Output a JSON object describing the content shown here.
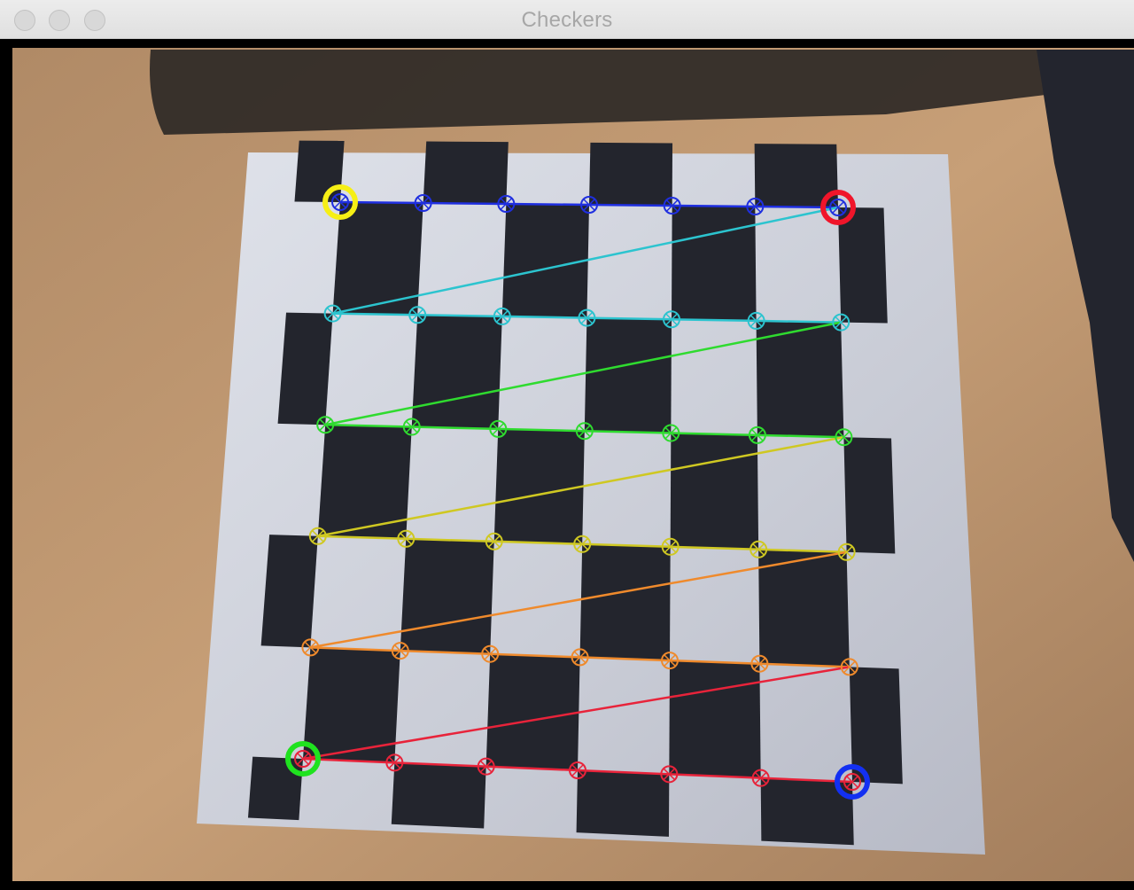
{
  "window": {
    "title": "Checkers"
  },
  "image_content": {
    "board": {
      "cols": 7,
      "rows": 6
    },
    "row_colors": [
      "#1f2fe0",
      "#2cc4cf",
      "#2fdb2f",
      "#cfc822",
      "#ef8a2c",
      "#e8233a"
    ],
    "start_markers": [
      {
        "corner": "first",
        "color": "#f6ef15"
      },
      {
        "corner": "top-right",
        "color": "#f0152a"
      },
      {
        "corner": "bottom-left",
        "color": "#1fe21f"
      },
      {
        "corner": "last",
        "color": "#1330f2"
      }
    ]
  }
}
